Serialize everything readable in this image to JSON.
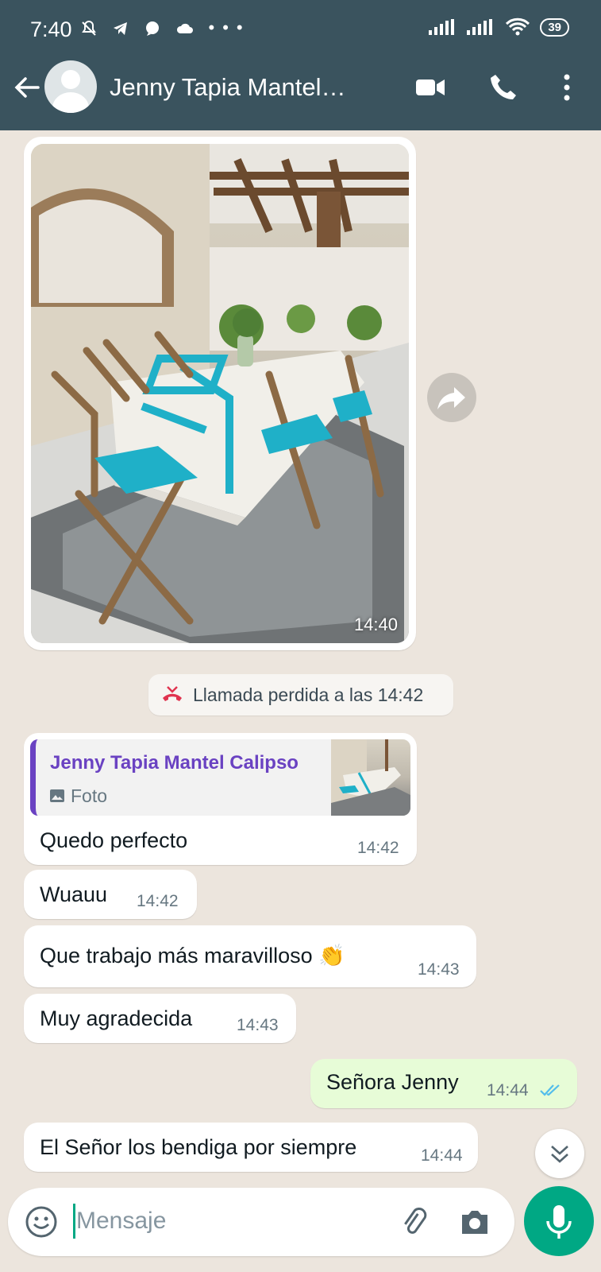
{
  "status_bar": {
    "time": "7:40",
    "icons": [
      "mute-icon",
      "telegram-icon",
      "chat-icon",
      "cloud-icon",
      "more-dots-icon"
    ],
    "battery": "39"
  },
  "header": {
    "contact_name": "Jenny Tapia Mantel…",
    "icons": [
      "back-arrow-icon",
      "avatar",
      "video-call-icon",
      "phone-icon",
      "overflow-menu-icon"
    ]
  },
  "messages": {
    "photo": {
      "time": "14:40"
    },
    "missed_call": {
      "text": "Llamada perdida a las 14:42"
    },
    "reply": {
      "quoted_name": "Jenny Tapia Mantel Calipso",
      "quoted_type": "Foto",
      "text": "Quedo perfecto",
      "time": "14:42"
    },
    "m2": {
      "text": "Wuauu",
      "time": "14:42"
    },
    "m3": {
      "text": "Que trabajo más maravilloso 👏",
      "time": "14:43"
    },
    "m4": {
      "text": "Muy agradecida",
      "time": "14:43"
    },
    "m5": {
      "text": "Señora Jenny",
      "time": "14:44",
      "status": "read"
    },
    "m6": {
      "text": "El Señor los bendiga por siempre",
      "time": "14:44"
    }
  },
  "input": {
    "placeholder": "Mensaje"
  },
  "colors": {
    "header": "#3a535e",
    "accent": "#00a884",
    "outgoing": "#e7fcd7",
    "quote_bar": "#6a42c2",
    "missed": "#e0334f",
    "read_ticks": "#53bdeb"
  }
}
